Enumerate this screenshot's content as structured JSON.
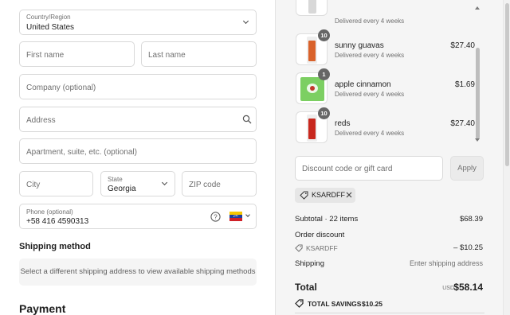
{
  "form": {
    "country": {
      "label": "Country/Region",
      "value": "United States"
    },
    "first_name_placeholder": "First name",
    "last_name_placeholder": "Last name",
    "company_placeholder": "Company (optional)",
    "address_placeholder": "Address",
    "apartment_placeholder": "Apartment, suite, etc. (optional)",
    "city_placeholder": "City",
    "state": {
      "label": "State",
      "value": "Georgia"
    },
    "zip_placeholder": "ZIP code",
    "phone": {
      "label": "Phone (optional)",
      "value": "+58 416 4590313"
    }
  },
  "shipping_method": {
    "heading": "Shipping method",
    "notice": "Select a different shipping address to view available shipping methods"
  },
  "payment": {
    "heading": "Payment"
  },
  "cart": {
    "partial_item": {
      "subtitle": "Delivered every 4 weeks"
    },
    "items": [
      {
        "qty": "10",
        "name": "sunny guavas",
        "subtitle": "Delivered every 4 weeks",
        "price": "$27.40",
        "color": "#d9622b"
      },
      {
        "qty": "1",
        "name": "apple cinnamon",
        "subtitle": "Delivered every 4 weeks",
        "price": "$1.69",
        "color": "#7ccf62"
      },
      {
        "qty": "10",
        "name": "reds",
        "subtitle": "Delivered every 4 weeks",
        "price": "$27.40",
        "color": "#c8281e"
      }
    ]
  },
  "discount": {
    "placeholder": "Discount code or gift card",
    "apply_label": "Apply",
    "applied_code": "KSARDFF"
  },
  "summary": {
    "subtotal_label": "Subtotal · 22 items",
    "subtotal_value": "$68.39",
    "order_discount_label": "Order discount",
    "discount_code": "KSARDFF",
    "discount_value": "– $10.25",
    "shipping_label": "Shipping",
    "shipping_value": "Enter shipping address",
    "total_label": "Total",
    "currency": "USD",
    "total_value": "$58.14",
    "savings_label": "TOTAL SAVINGS",
    "savings_value": "$10.25"
  },
  "colors": {
    "accent": "#1f1f1f",
    "panel": "#f5f5f5",
    "border": "#d9d9d9"
  }
}
